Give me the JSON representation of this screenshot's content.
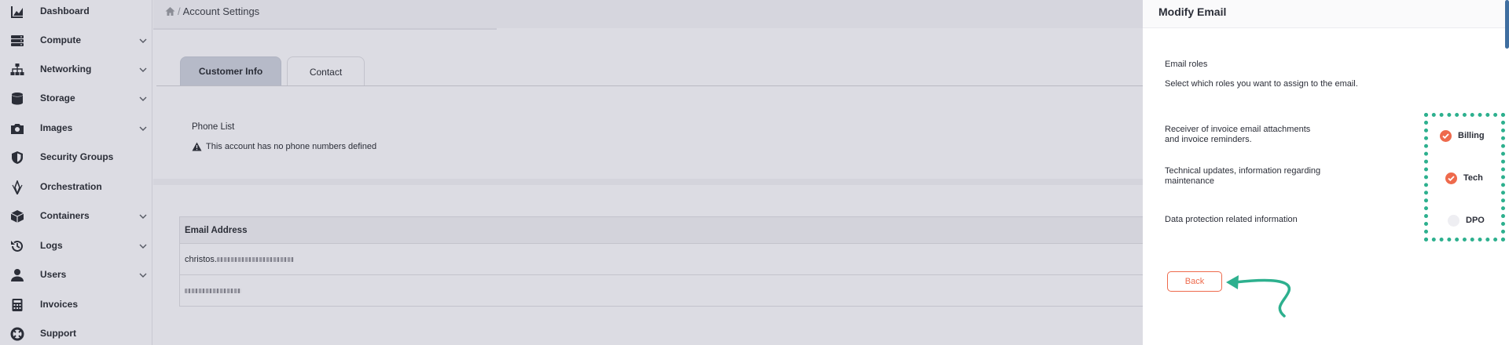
{
  "sidebar": {
    "items": [
      {
        "label": "Dashboard",
        "icon": "chart-area-icon",
        "has_chevron": false
      },
      {
        "label": "Compute",
        "icon": "server-icon",
        "has_chevron": true
      },
      {
        "label": "Networking",
        "icon": "sitemap-icon",
        "has_chevron": true
      },
      {
        "label": "Storage",
        "icon": "database-icon",
        "has_chevron": true
      },
      {
        "label": "Images",
        "icon": "camera-icon",
        "has_chevron": true
      },
      {
        "label": "Security Groups",
        "icon": "shield-icon",
        "has_chevron": false
      },
      {
        "label": "Orchestration",
        "icon": "layers-icon",
        "has_chevron": false
      },
      {
        "label": "Containers",
        "icon": "box-icon",
        "has_chevron": true
      },
      {
        "label": "Logs",
        "icon": "history-icon",
        "has_chevron": true
      },
      {
        "label": "Users",
        "icon": "user-icon",
        "has_chevron": true
      },
      {
        "label": "Invoices",
        "icon": "calculator-icon",
        "has_chevron": false
      },
      {
        "label": "Support",
        "icon": "life-ring-icon",
        "has_chevron": false
      }
    ]
  },
  "breadcrumb": {
    "separator": "/",
    "current": "Account Settings"
  },
  "tabs": [
    {
      "label": "Customer Info",
      "active": false
    },
    {
      "label": "Contact",
      "active": true
    }
  ],
  "phone": {
    "title": "Phone List",
    "empty_message": "This account has no phone numbers defined"
  },
  "emails": {
    "header": "Email Address",
    "rows": [
      {
        "visible_text": "christos."
      },
      {
        "visible_text": ""
      }
    ]
  },
  "panel": {
    "title": "Modify Email",
    "roles_title": "Email roles",
    "roles_subtitle": "Select which roles you want to assign to the email.",
    "roles": [
      {
        "description_line1": "Receiver of invoice email attachments",
        "description_line2": "and invoice reminders.",
        "label": "Billing",
        "checked": true
      },
      {
        "description_line1": "Technical updates, information regarding",
        "description_line2": "maintenance",
        "label": "Tech",
        "checked": true
      },
      {
        "description_line1": "Data protection related information",
        "description_line2": "",
        "label": "DPO",
        "checked": false
      }
    ],
    "back_label": "Back"
  },
  "colors": {
    "accent": "#ee6a4c",
    "highlight": "#2db08e",
    "background": "#dcdce3",
    "panel": "#ffffff",
    "tab_inactive": "#b6bac8"
  }
}
